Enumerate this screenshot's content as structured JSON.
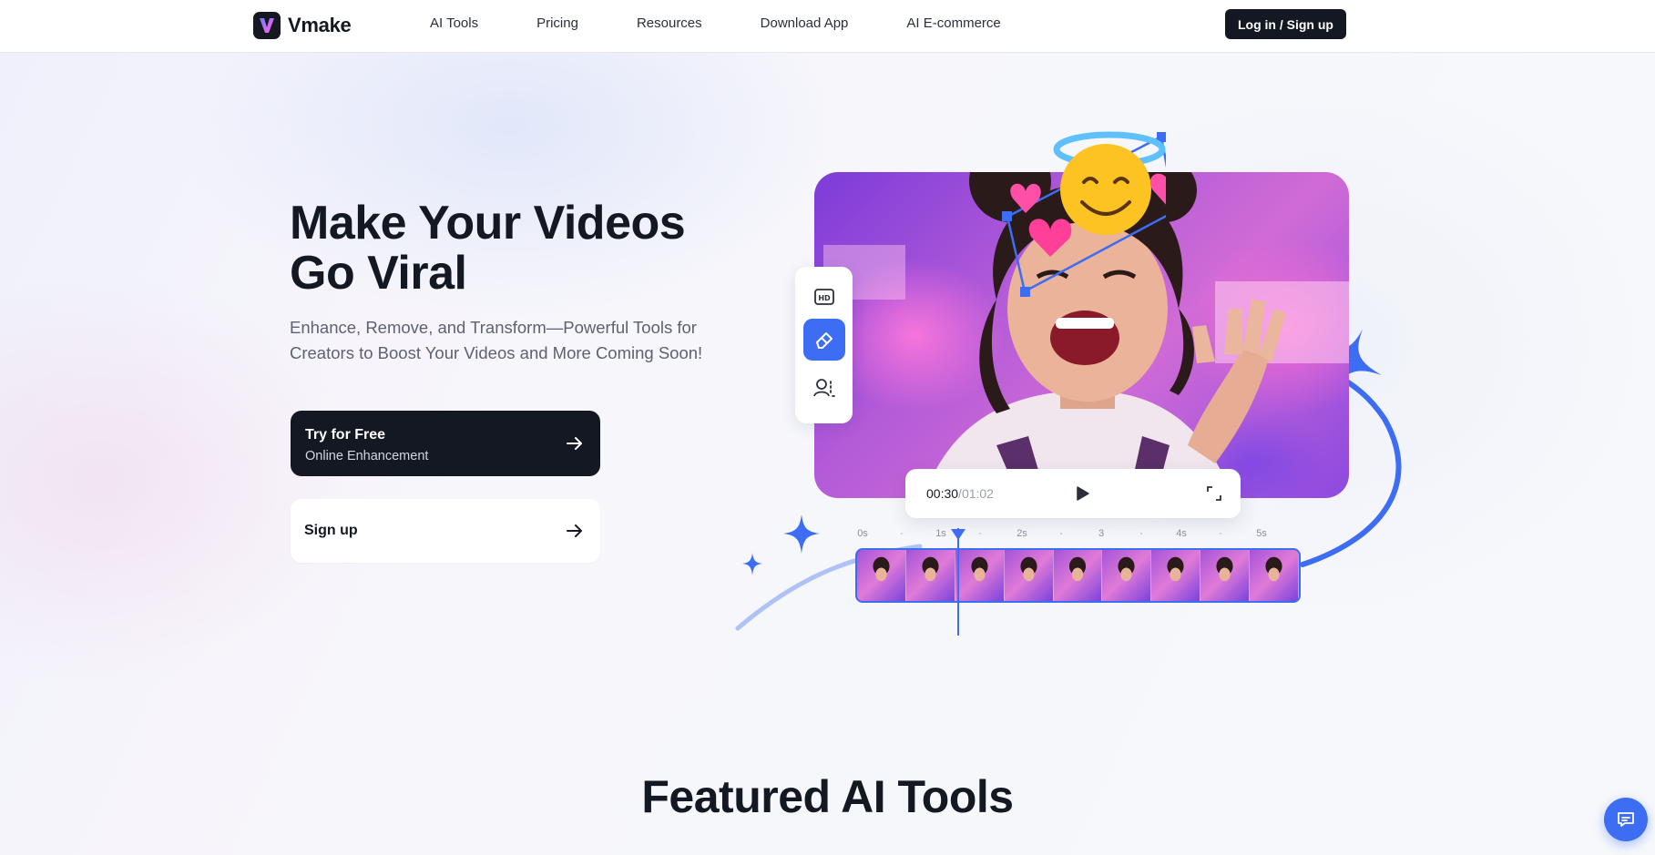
{
  "header": {
    "logo_text": "Vmake",
    "nav": [
      "AI Tools",
      "Pricing",
      "Resources",
      "Download App",
      "AI E-commerce"
    ],
    "login_label": "Log in / Sign up"
  },
  "hero": {
    "title_line1": "Make Your Videos",
    "title_line2": "Go Viral",
    "subtitle": "Enhance, Remove, and Transform—Powerful Tools for Creators to Boost Your Videos and More Coming Soon!",
    "primary_cta": {
      "title": "Try for Free",
      "subtitle": "Online Enhancement"
    },
    "secondary_cta": {
      "title": "Sign up"
    }
  },
  "player": {
    "current_time": "00:30",
    "separator": "/",
    "total_time": "01:02",
    "ruler_ticks": [
      "0s",
      "·",
      "1s",
      "·",
      "2s",
      "·",
      "3",
      "·",
      "4s",
      "·",
      "5s"
    ],
    "frame_count": 9
  },
  "tools": [
    "hd-icon",
    "eraser-icon",
    "person-remove-icon"
  ],
  "featured": {
    "title": "Featured AI Tools"
  },
  "colors": {
    "accent": "#3d6df2",
    "dark": "#141823"
  }
}
